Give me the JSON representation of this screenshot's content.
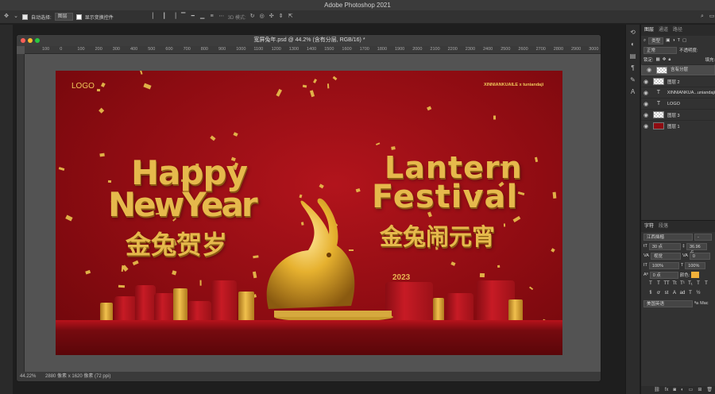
{
  "app": {
    "title": "Adobe Photoshop 2021"
  },
  "options_bar": {
    "auto_select_label": "自动选择:",
    "auto_select_value": "图层",
    "show_transform_label": "显示变换控件",
    "mode_3d_label": "3D 模式:"
  },
  "document": {
    "title": "宽屏兔年.psd @ 44.2% (含有分层, RGB/16) *",
    "zoom": "44.22%",
    "doc_size": "2880 像素 x 1620 像素 (72 ppi)",
    "ruler_ticks": [
      "100",
      "0",
      "100",
      "200",
      "300",
      "400",
      "500",
      "600",
      "700",
      "800",
      "900",
      "1000",
      "1100",
      "1200",
      "1300",
      "1400",
      "1500",
      "1600",
      "1700",
      "1800",
      "1900",
      "2000",
      "2100",
      "2200",
      "2300",
      "2400",
      "2500",
      "2600",
      "2700",
      "2800",
      "2900",
      "3000"
    ]
  },
  "artwork": {
    "logo": "LOGO",
    "brand": "XINNIANKUAILE x tuniandaji",
    "happy": "Happy",
    "new_year": "NewYear",
    "cn_left": "金兔贺岁",
    "lantern": "Lantern",
    "festival": "Festival",
    "cn_right": "金兔闹元宵",
    "year": "2023"
  },
  "layers_panel": {
    "tabs": [
      "图层",
      "通道",
      "路径"
    ],
    "filter_label": "类型",
    "blend_mode": "正常",
    "opacity_label": "不透明度:",
    "lock_label": "锁定:",
    "fill_label": "填充:",
    "layers": [
      {
        "name": "含有分层",
        "type": "group",
        "selected": true
      },
      {
        "name": "图层 2",
        "type": "pixel"
      },
      {
        "name": "XINNIANKUA...uniandaji",
        "type": "text"
      },
      {
        "name": "LOGO",
        "type": "text"
      },
      {
        "name": "图层 3",
        "type": "pixel"
      },
      {
        "name": "图层 1",
        "type": "red"
      }
    ]
  },
  "character_panel": {
    "tabs": [
      "字符",
      "段落"
    ],
    "font_family": "江西拙楷",
    "font_style": "-",
    "font_size": "30 点",
    "leading": "36.96 点",
    "kerning": "视觉",
    "tracking": "0",
    "vscale": "100%",
    "hscale": "100%",
    "baseline": "0 点",
    "color_label": "颜色:",
    "language": "美国英语",
    "aa": "Mac"
  },
  "colors": {
    "canvas_red": "#8e0c12",
    "gold": "#e6b94c",
    "swatch": "#f0b03a"
  }
}
